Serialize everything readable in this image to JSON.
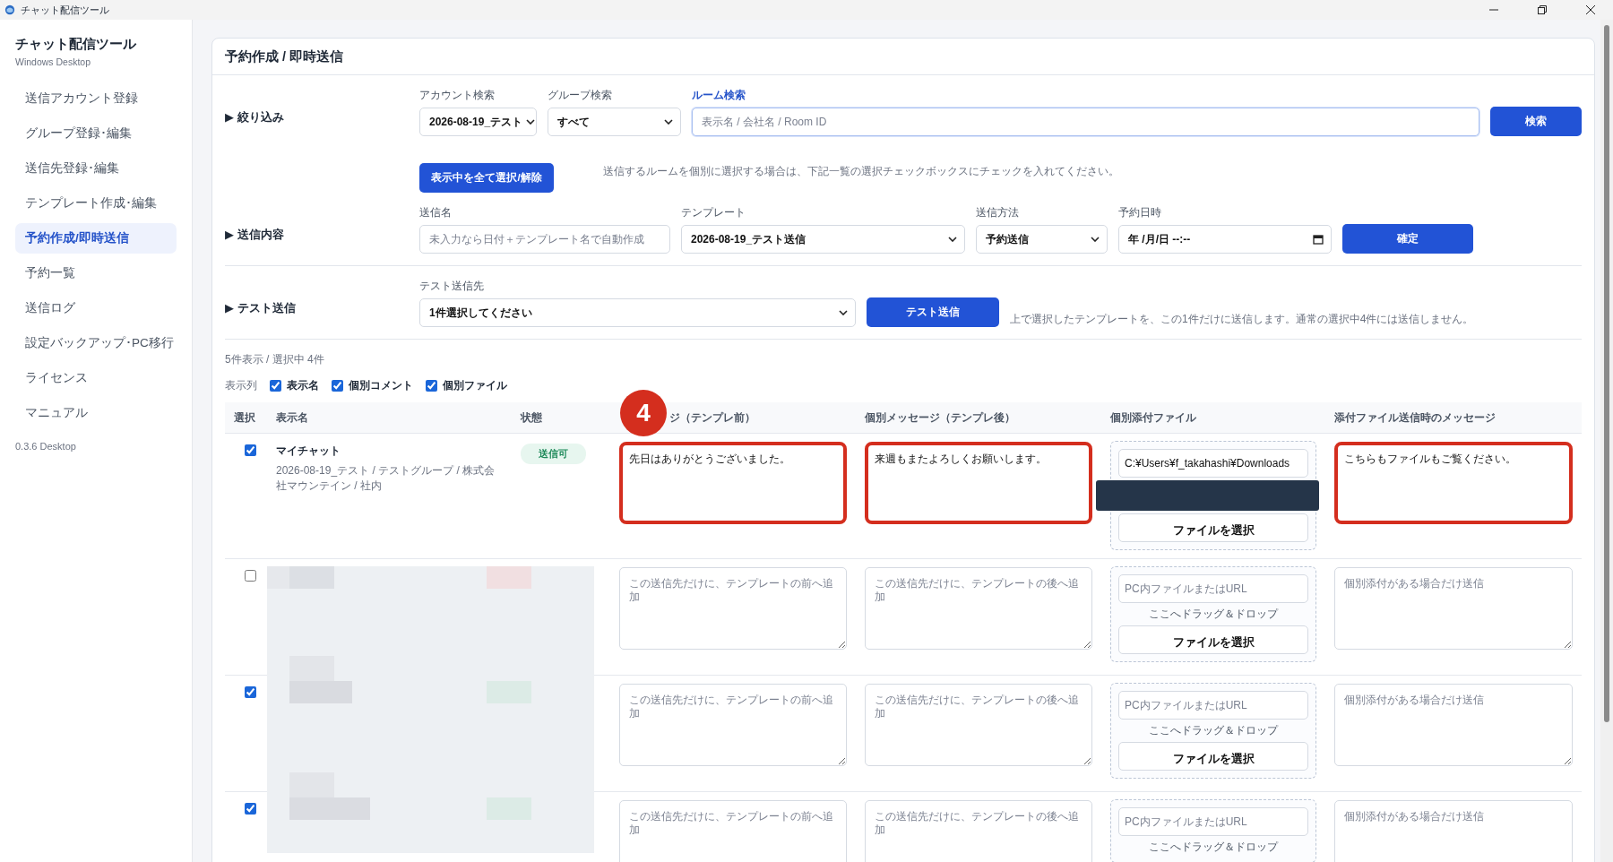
{
  "window": {
    "title": "チャット配信ツール"
  },
  "sidebar": {
    "app_name": "チャット配信ツール",
    "subtitle": "Windows Desktop",
    "items": [
      {
        "label": "送信アカウント登録",
        "selected": false
      },
      {
        "label": "グループ登録･編集",
        "selected": false
      },
      {
        "label": "送信先登録･編集",
        "selected": false
      },
      {
        "label": "テンプレート作成･編集",
        "selected": false
      },
      {
        "label": "予約作成/即時送信",
        "selected": true
      },
      {
        "label": "予約一覧",
        "selected": false
      },
      {
        "label": "送信ログ",
        "selected": false
      },
      {
        "label": "設定バックアップ･PC移行",
        "selected": false
      },
      {
        "label": "ライセンス",
        "selected": false
      },
      {
        "label": "マニュアル",
        "selected": false
      }
    ],
    "version": "0.3.6 Desktop"
  },
  "page": {
    "title": "予約作成 / 即時送信"
  },
  "filter": {
    "label": "▶ 絞り込み",
    "account": {
      "label": "アカウント検索",
      "value": "2026-08-19_テスト"
    },
    "group": {
      "label": "グループ検索",
      "value": "すべて"
    },
    "room": {
      "label": "ルーム検索",
      "placeholder": "表示名 / 会社名 / Room ID",
      "focused": true
    },
    "search_button": "検索",
    "select_all_button": "表示中を全て選択/解除",
    "hint": "送信するルームを個別に選択する場合は、下記一覧の選択チェックボックスにチェックを入れてください。"
  },
  "send_content": {
    "label": "▶ 送信内容",
    "name": {
      "label": "送信名",
      "placeholder": "未入力なら日付＋テンプレート名で自動作成"
    },
    "template": {
      "label": "テンプレート",
      "value": "2026-08-19_テスト送信"
    },
    "method": {
      "label": "送信方法",
      "value": "予約送信"
    },
    "datetime": {
      "label": "予約日時",
      "value": "年 /月/日  --:--"
    },
    "confirm_button": "確定"
  },
  "test_send": {
    "label": "▶ テスト送信",
    "target": {
      "label": "テスト送信先",
      "value": "1件選択してください"
    },
    "button": "テスト送信",
    "hint": "上で選択したテンプレートを、この1件だけに送信します。通常の選択中4件には送信しません。"
  },
  "summary": "5件表示 / 選択中 4件",
  "column_toggles": {
    "label": "表示列",
    "options": [
      {
        "label": "表示名",
        "checked": true
      },
      {
        "label": "個別コメント",
        "checked": true
      },
      {
        "label": "個別ファイル",
        "checked": true
      }
    ]
  },
  "table": {
    "columns": [
      "選択",
      "表示名",
      "状態",
      "ジ（テンプレ前）",
      "個別メッセージ（テンプレ後）",
      "個別添付ファイル",
      "添付ファイル送信時のメッセージ"
    ],
    "rows": [
      {
        "kind": "shown",
        "selected": true,
        "highlighted": true,
        "name": "マイチャット",
        "detail": "2026-08-19_テスト / テストグループ / 株式会社マウンテイン / 社内",
        "status": "送信可",
        "before": {
          "value": "先日はありがとうございました。"
        },
        "after": {
          "value": "来週もまたよろしくお願いします。"
        },
        "file": {
          "value": "C:¥Users¥f_takahashi¥Downloads",
          "covered": true,
          "button": "ファイルを選択"
        },
        "attach_message": {
          "value": "こちらもファイルもご覧ください。"
        }
      },
      {
        "kind": "redacted",
        "selected": false,
        "highlighted": false,
        "before": {
          "placeholder": "この送信先だけに、テンプレートの前へ追加"
        },
        "after": {
          "placeholder": "この送信先だけに、テンプレートの後へ追加"
        },
        "file": {
          "placeholder": "PC内ファイルまたはURL",
          "covered": false,
          "drop_hint": "ここへドラッグ＆ドロップ",
          "button": "ファイルを選択"
        },
        "attach_message": {
          "placeholder": "個別添付がある場合だけ送信"
        }
      },
      {
        "kind": "redacted",
        "selected": true,
        "highlighted": false,
        "before": {
          "placeholder": "この送信先だけに、テンプレートの前へ追加"
        },
        "after": {
          "placeholder": "この送信先だけに、テンプレートの後へ追加"
        },
        "file": {
          "placeholder": "PC内ファイルまたはURL",
          "covered": false,
          "drop_hint": "ここへドラッグ＆ドロップ",
          "button": "ファイルを選択"
        },
        "attach_message": {
          "placeholder": "個別添付がある場合だけ送信"
        }
      },
      {
        "kind": "redacted",
        "selected": true,
        "highlighted": false,
        "before": {
          "placeholder": "この送信先だけに、テンプレートの前へ追加"
        },
        "after": {
          "placeholder": "この送信先だけに、テンプレートの後へ追加"
        },
        "file": {
          "placeholder": "PC内ファイルまたはURL",
          "covered": false,
          "drop_hint": "ここへドラッグ＆ドロップ"
        },
        "attach_message": {
          "placeholder": "個別添付がある場合だけ送信"
        }
      }
    ]
  },
  "annotation": {
    "badge": "4"
  }
}
